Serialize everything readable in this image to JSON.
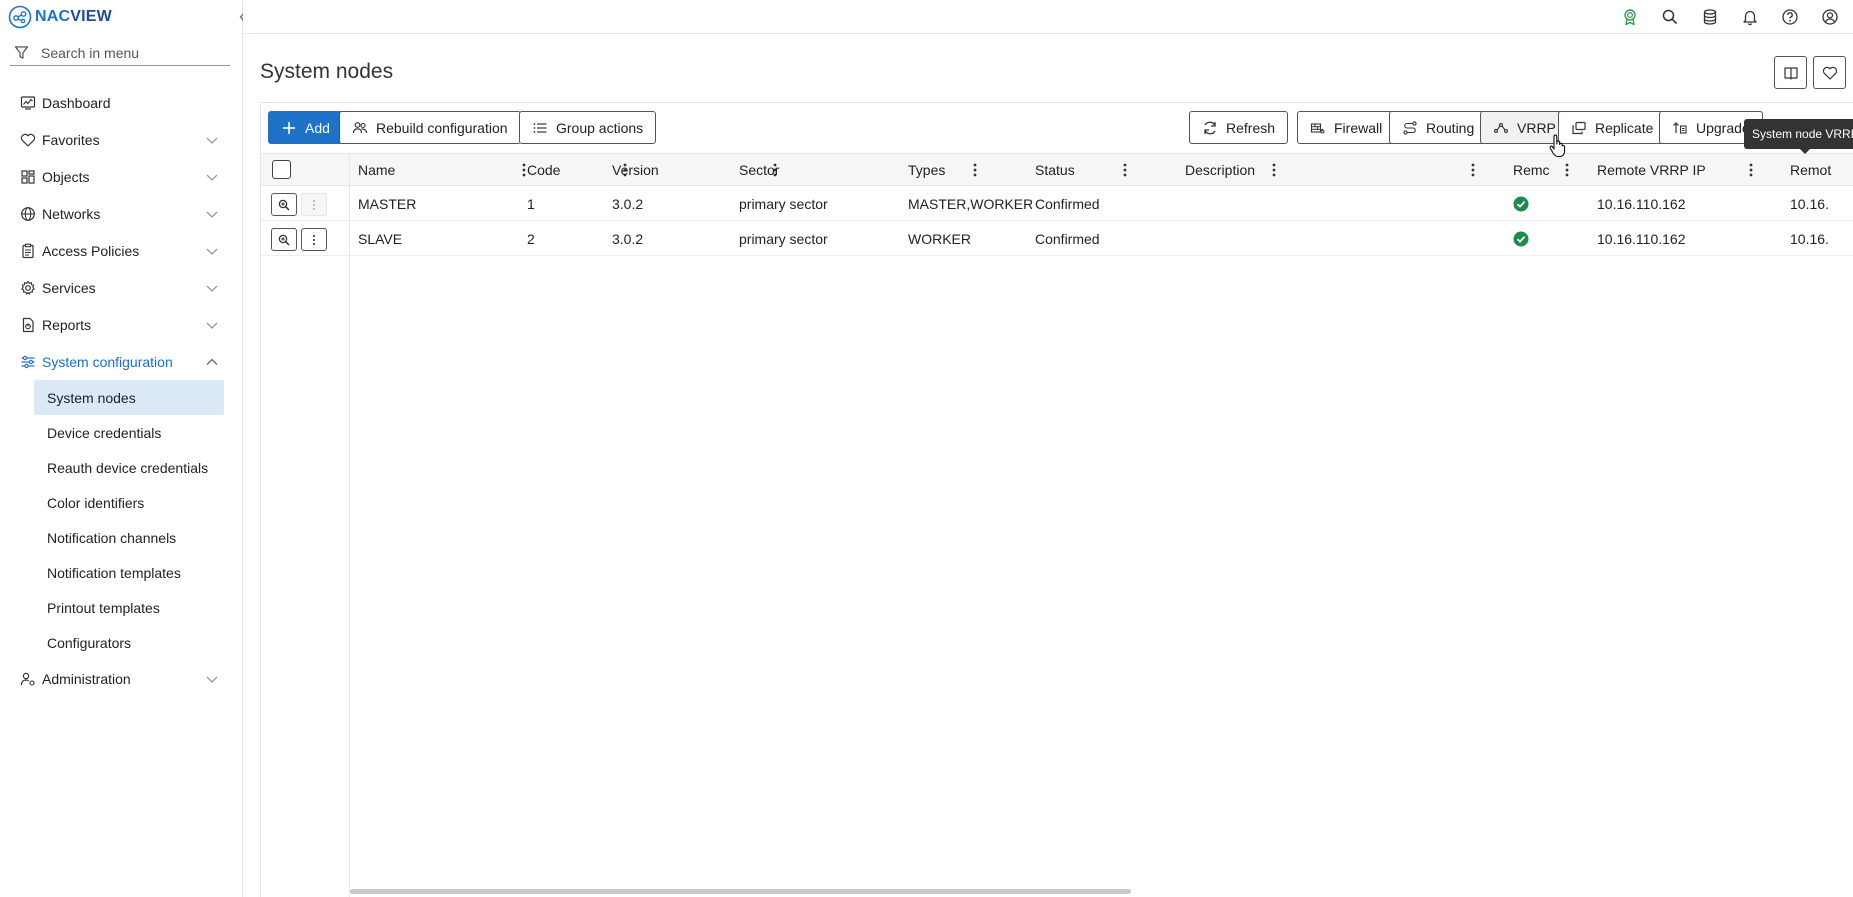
{
  "brand": {
    "part1": "NAC",
    "part2": "VIEW"
  },
  "search": {
    "placeholder": "Search in menu"
  },
  "colors": {
    "accent": "#1e73c9",
    "selected_bg": "#dbe8f6",
    "ok_green": "#1e8a4e",
    "tooltip_bg": "#333333"
  },
  "nav": {
    "items": [
      {
        "label": "Dashboard",
        "icon": "dashboard-icon"
      },
      {
        "label": "Favorites",
        "icon": "heart-icon"
      },
      {
        "label": "Objects",
        "icon": "objects-icon"
      },
      {
        "label": "Networks",
        "icon": "globe-icon"
      },
      {
        "label": "Access Policies",
        "icon": "clipboard-icon"
      },
      {
        "label": "Services",
        "icon": "gear-icon"
      },
      {
        "label": "Reports",
        "icon": "report-icon"
      },
      {
        "label": "System configuration",
        "icon": "sliders-icon"
      },
      {
        "label": "Administration",
        "icon": "user-cog-icon"
      }
    ],
    "sub": [
      "System nodes",
      "Device credentials",
      "Reauth device credentials",
      "Color identifiers",
      "Notification channels",
      "Notification templates",
      "Printout templates",
      "Configurators"
    ]
  },
  "page": {
    "title": "System nodes"
  },
  "toolbar": {
    "add": "Add",
    "rebuild": "Rebuild configuration",
    "group": "Group actions",
    "refresh": "Refresh",
    "firewall": "Firewall",
    "routing": "Routing",
    "vrrp": "VRRP",
    "replicate": "Replicate",
    "upgrade": "Upgrade"
  },
  "tooltip": "System node VRRP",
  "table": {
    "columns": [
      "Name",
      "Code",
      "Version",
      "Sector",
      "Types",
      "Status",
      "Description",
      "Remc",
      "Remote VRRP IP",
      "Remot"
    ],
    "rows": [
      {
        "name": "MASTER",
        "code": "1",
        "version": "3.0.2",
        "sector": "primary sector",
        "types": "MASTER,WORKER...",
        "status": "Confirmed",
        "description": "",
        "remote_ok": true,
        "vrrp_ip": "10.16.110.162",
        "remote2": "10.16."
      },
      {
        "name": "SLAVE",
        "code": "2",
        "version": "3.0.2",
        "sector": "primary sector",
        "types": "WORKER",
        "status": "Confirmed",
        "description": "",
        "remote_ok": true,
        "vrrp_ip": "10.16.110.162",
        "remote2": "10.16."
      }
    ]
  }
}
